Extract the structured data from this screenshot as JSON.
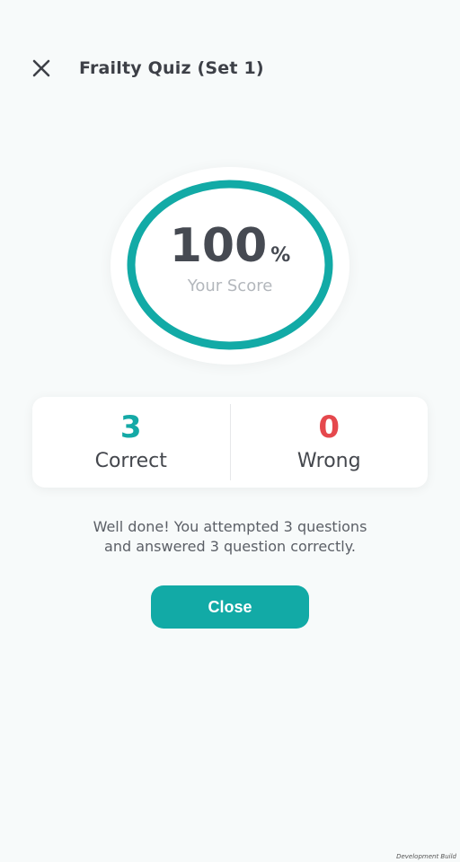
{
  "header": {
    "title": "Frailty Quiz (Set 1)",
    "close_icon": "close-icon"
  },
  "score": {
    "value": "100",
    "unit": "%",
    "caption": "Your Score",
    "ring_color": "#12aaa6",
    "progress": 1.0
  },
  "stats": {
    "correct_count": "3",
    "correct_label": "Correct",
    "wrong_count": "0",
    "wrong_label": "Wrong",
    "correct_color": "#14a9a6",
    "wrong_color": "#e5484d"
  },
  "message": {
    "line1": "Well done! You attempted 3 questions",
    "line2": "and answered 3 question correctly."
  },
  "actions": {
    "close_label": "Close"
  },
  "footer": {
    "note": "Development Build"
  }
}
